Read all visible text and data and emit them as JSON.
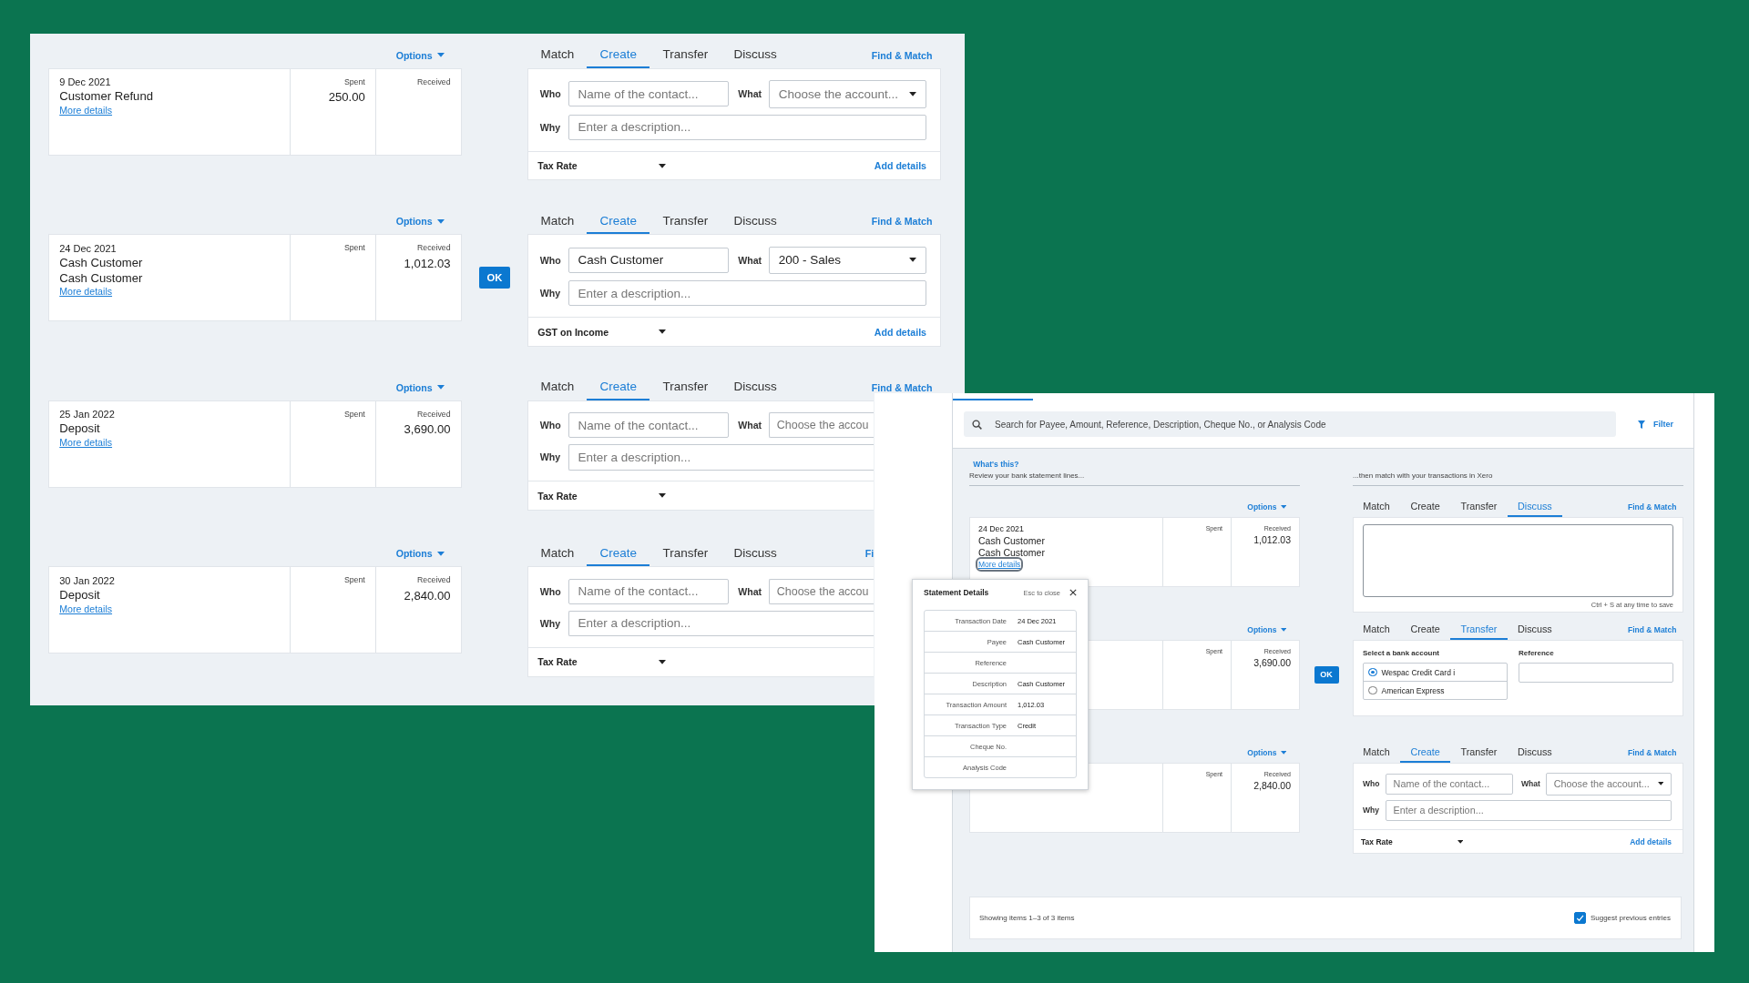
{
  "left_window": {
    "rows": [
      {
        "options": "Options",
        "statement": {
          "date": "9 Dec 2021",
          "lines": [
            "Customer Refund"
          ],
          "more_details": {
            "label": "More details",
            "focused": false
          },
          "spent_label": "Spent",
          "spent": "250.00",
          "received_label": "Received"
        },
        "tabs": [
          {
            "label": "Match",
            "selected": false
          },
          {
            "label": "Create",
            "selected": true
          },
          {
            "label": "Transfer",
            "selected": false
          },
          {
            "label": "Discuss",
            "selected": false
          }
        ],
        "find_match": "Find & Match",
        "form": {
          "kind": "create",
          "who": {
            "label": "Who",
            "placeholder": "Name of the contact..."
          },
          "what": {
            "label": "What",
            "placeholder": "Choose the account..."
          },
          "why": {
            "label": "Why",
            "placeholder": "Enter a description..."
          },
          "tax": "Tax Rate",
          "add_details": "Add details"
        }
      },
      {
        "options": "Options",
        "statement": {
          "date": "24 Dec 2021",
          "lines": [
            "Cash Customer",
            "Cash Customer"
          ],
          "more_details": {
            "label": "More details",
            "focused": false
          },
          "spent_label": "Spent",
          "received_label": "Received",
          "received": "1,012.03"
        },
        "ok": "OK",
        "tabs": [
          {
            "label": "Match",
            "selected": false
          },
          {
            "label": "Create",
            "selected": true
          },
          {
            "label": "Transfer",
            "selected": false
          },
          {
            "label": "Discuss",
            "selected": false
          }
        ],
        "find_match": "Find & Match",
        "form": {
          "kind": "create",
          "who": {
            "label": "Who",
            "value": "Cash Customer"
          },
          "what": {
            "label": "What",
            "value": "200 - Sales"
          },
          "why": {
            "label": "Why",
            "placeholder": "Enter a description..."
          },
          "tax": "GST on Income",
          "add_details": "Add details"
        }
      },
      {
        "options": "Options",
        "statement": {
          "date": "25 Jan 2022",
          "lines": [
            "Deposit"
          ],
          "more_details": {
            "label": "More details",
            "focused": false
          },
          "spent_label": "Spent",
          "received_label": "Received",
          "received": "3,690.00"
        },
        "tabs": [
          {
            "label": "Match",
            "selected": false
          },
          {
            "label": "Create",
            "selected": true
          },
          {
            "label": "Transfer",
            "selected": false
          },
          {
            "label": "Discuss",
            "selected": false
          }
        ],
        "find_match": "Find & Match",
        "form": {
          "kind": "create",
          "who": {
            "label": "Who",
            "placeholder": "Name of the contact..."
          },
          "what": {
            "label": "What",
            "placeholder": "Choose the accou"
          },
          "why": {
            "label": "Why",
            "placeholder": "Enter a description..."
          },
          "tax": "Tax Rate"
        }
      },
      {
        "options": "Options",
        "statement": {
          "date": "30 Jan 2022",
          "lines": [
            "Deposit"
          ],
          "more_details": {
            "label": "More details",
            "focused": false
          },
          "spent_label": "Spent",
          "received_label": "Received",
          "received": "2,840.00"
        },
        "tabs": [
          {
            "label": "Match",
            "selected": false
          },
          {
            "label": "Create",
            "selected": true
          },
          {
            "label": "Transfer",
            "selected": false
          },
          {
            "label": "Discuss",
            "selected": false
          }
        ],
        "find_match": "Fi",
        "form": {
          "kind": "create",
          "who": {
            "label": "Who",
            "placeholder": "Name of the contact..."
          },
          "what": {
            "label": "What",
            "placeholder": "Choose the accou"
          },
          "why": {
            "label": "Why",
            "placeholder": "Enter a description..."
          },
          "tax": "Tax Rate"
        }
      }
    ]
  },
  "right_window": {
    "search": {
      "placeholder": "Search for Payee, Amount, Reference, Description, Cheque No., or Analysis Code"
    },
    "filter": "Filter",
    "whats_this": "What's this?",
    "left_caption": "Review your bank statement lines...",
    "right_caption": "...then match with your transactions in Xero",
    "rows": [
      {
        "options": "Options",
        "statement": {
          "date": "24 Dec 2021",
          "lines": [
            "Cash Customer",
            "Cash Customer"
          ],
          "more_details": {
            "label": "More details",
            "focused": true
          },
          "spent_label": "Spent",
          "received_label": "Received",
          "received": "1,012.03"
        },
        "tabs": [
          {
            "label": "Match",
            "selected": false
          },
          {
            "label": "Create",
            "selected": false
          },
          {
            "label": "Transfer",
            "selected": false
          },
          {
            "label": "Discuss",
            "selected": true
          }
        ],
        "find_match": "Find & Match",
        "form": {
          "kind": "discuss",
          "hint": "Ctrl + S at any time to save"
        }
      },
      {
        "options": "Options",
        "statement": {
          "spent_label": "Spent",
          "received_label": "Received",
          "received": "3,690.00"
        },
        "ok": "OK",
        "tabs": [
          {
            "label": "Match",
            "selected": false
          },
          {
            "label": "Create",
            "selected": false
          },
          {
            "label": "Transfer",
            "selected": true
          },
          {
            "label": "Discuss",
            "selected": false
          }
        ],
        "find_match": "Find & Match",
        "form": {
          "kind": "transfer",
          "account_label": "Select a bank account",
          "accounts": [
            {
              "label": "Wespac Credit Card i",
              "selected": true
            },
            {
              "label": "American Express",
              "selected": false
            }
          ],
          "reference_label": "Reference"
        }
      },
      {
        "options": "Options",
        "statement": {
          "spent_label": "Spent",
          "received_label": "Received",
          "received": "2,840.00"
        },
        "tabs": [
          {
            "label": "Match",
            "selected": false
          },
          {
            "label": "Create",
            "selected": true
          },
          {
            "label": "Transfer",
            "selected": false
          },
          {
            "label": "Discuss",
            "selected": false
          }
        ],
        "find_match": "Find & Match",
        "form": {
          "kind": "create",
          "who": {
            "label": "Who",
            "placeholder": "Name of the contact..."
          },
          "what": {
            "label": "What",
            "placeholder": "Choose the account..."
          },
          "why": {
            "label": "Why",
            "placeholder": "Enter a description..."
          },
          "tax": "Tax Rate",
          "add_details": "Add details"
        }
      }
    ],
    "footer": {
      "showing": "Showing items 1–3 of 3 items",
      "suggest": {
        "label": "Suggest previous entries",
        "checked": true
      }
    },
    "popup": {
      "title": "Statement Details",
      "esc_hint": "Esc to close",
      "rows": [
        {
          "label": "Transaction Date",
          "value": "24 Dec 2021"
        },
        {
          "label": "Payee",
          "value": "Cash Customer"
        },
        {
          "label": "Reference"
        },
        {
          "label": "Description",
          "value": "Cash Customer"
        },
        {
          "label": "Transaction Amount",
          "value": "1,012.03"
        },
        {
          "label": "Transaction Type",
          "value": "Credit"
        },
        {
          "label": "Cheque No."
        },
        {
          "label": "Analysis Code"
        }
      ]
    }
  }
}
